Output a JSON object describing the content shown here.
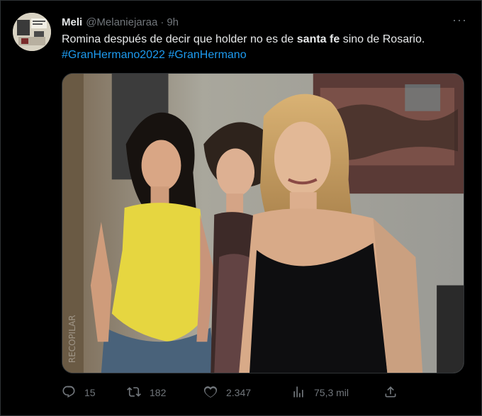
{
  "tweet": {
    "display_name": "Meli",
    "handle": "@Melaniejaraa",
    "separator": "·",
    "time": "9h",
    "more_label": "···",
    "text_part1": "Romina después de decir que holder no es de ",
    "text_bold": "santa fe",
    "text_part2": " sino de Rosario.",
    "hashtag1": "#GranHermano2022",
    "hashtag2": "#GranHermano",
    "watermark": "RECOPILAR"
  },
  "actions": {
    "reply_count": "15",
    "retweet_count": "182",
    "like_count": "2.347",
    "views_count": "75,3 mil"
  },
  "icons": {
    "reply": "reply-icon",
    "retweet": "retweet-icon",
    "like": "heart-icon",
    "views": "views-icon",
    "share": "share-icon",
    "more": "more-icon"
  },
  "colors": {
    "background": "#000000",
    "text": "#e7e9ea",
    "muted": "#71767b",
    "link": "#1d9bf0",
    "border": "#2f3336"
  }
}
